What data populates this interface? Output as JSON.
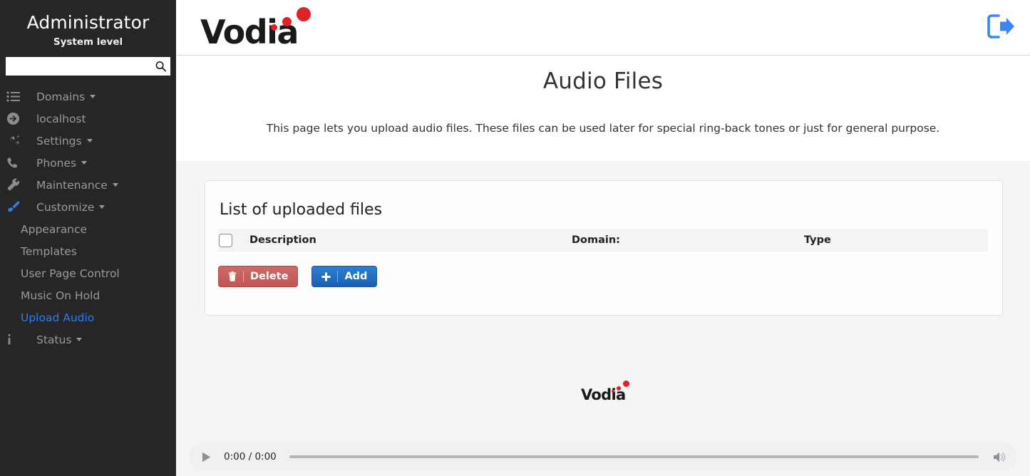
{
  "sidebar": {
    "title": "Administrator",
    "subtitle": "System level",
    "search": {
      "value": "",
      "placeholder": ""
    },
    "items": [
      {
        "label": "Domains",
        "icon": "list-icon",
        "caret": true,
        "type": "parent"
      },
      {
        "label": "localhost",
        "icon": "arrow-circle-icon",
        "caret": false,
        "type": "parent"
      },
      {
        "label": "Settings",
        "icon": "gears-icon",
        "caret": true,
        "type": "parent"
      },
      {
        "label": "Phones",
        "icon": "phone-icon",
        "caret": true,
        "type": "parent"
      },
      {
        "label": "Maintenance",
        "icon": "wrench-icon",
        "caret": true,
        "type": "parent"
      },
      {
        "label": "Customize",
        "icon": "paintbrush-icon",
        "caret": true,
        "type": "parent"
      }
    ],
    "sub_items": [
      {
        "label": "Appearance",
        "active": false
      },
      {
        "label": "Templates",
        "active": false
      },
      {
        "label": "User Page Control",
        "active": false
      },
      {
        "label": "Music On Hold",
        "active": false
      },
      {
        "label": "Upload Audio",
        "active": true
      }
    ],
    "status_item": {
      "label": "Status",
      "icon": "info-icon",
      "caret": true
    }
  },
  "header": {
    "logo_text": "Vodia",
    "logout_label": "logout-icon"
  },
  "page": {
    "title": "Audio Files",
    "description": "This page lets you upload audio files. These files can be used later for special ring-back tones or just for general purpose."
  },
  "card": {
    "title": "List of uploaded files",
    "columns": [
      "Description",
      "Domain:",
      "Type"
    ],
    "rows": [],
    "buttons": {
      "delete": "Delete",
      "add": "Add"
    }
  },
  "footer": {
    "logo_text": "Vodia"
  },
  "player": {
    "time": "0:00 / 0:00",
    "progress_percent": 0,
    "play_label": "play-icon",
    "volume_label": "volume-icon"
  },
  "colors": {
    "sidebar_bg": "#262626",
    "accent_blue": "#2f7ced",
    "logo_red": "#e02128",
    "delete_red": "#c05754",
    "add_blue": "#1b5fb0",
    "page_bg": "#f5f5f5"
  }
}
